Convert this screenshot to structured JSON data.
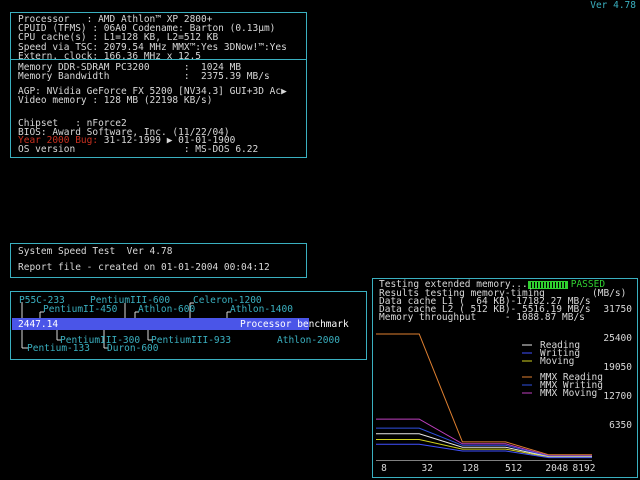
{
  "version": "Ver 4.78",
  "info": {
    "lines": [
      "Processor   : AMD Athlon™ XP 2800+",
      "CPUID (TFMS) : 06A0 Codename: Barton (0.13µm)",
      "CPU cache(s) : L1=128 KB, L2=512 KB",
      "Speed via TSC: 2079.54 MHz MMX™:Yes 3DNow!™:Yes",
      "Extern. clock: 166.36 MHz x 12.5"
    ],
    "memory_line": "Memory DDR-SDRAM PC3200      :  1024 MB",
    "bandwidth_line": "Memory Bandwidth             :  2375.39 MB/s",
    "agp_line": "AGP: NVidia GeForce FX 5200 [NV34.3] GUI+3D Ac",
    "agp_arrow": "▶",
    "video_line": "Video memory : 128 MB (22198 KB/s)",
    "chipset_line": "Chipset   : nForce2",
    "bios_line": "BIOS: Award Software, Inc. (11/22/04)",
    "y2k_label": "Year 2000 Bug:",
    "y2k_value": " 31-12-1999 ▶ 01-01-1900",
    "os_line": "OS version                   : MS-DOS 6.22"
  },
  "speed": {
    "line1": "System Speed Test  Ver 4.78",
    "line2": "Report file - created on 01-01-2004 00:04:12"
  },
  "benchmark": {
    "value": "2447.14",
    "bar_label": "Processor benchmark",
    "bar_fraction": 0.845,
    "top_labels": [
      "P55C-233",
      "PentiumIII-600",
      "Celeron-1200",
      "PentiumII-450",
      "Athlon-600",
      "Athlon-1400"
    ],
    "bottom_labels": [
      "PentiumIII-300",
      "PentiumIII-933",
      "Athlon-2000",
      "Pentium-133",
      "Duron-600"
    ]
  },
  "memtest": {
    "title": "Testing extended memory...",
    "status": "PASSED",
    "results": "Results testing memory-timing",
    "unit": "(MB/s)",
    "l1": "Data cache L1 (  64 KB)-17182.27 MB/s",
    "l2": "Data cache L2 ( 512 KB)- 5516.19 MB/s",
    "mem": "Memory throughput     - 1088.87 MB/s"
  },
  "chart_data": {
    "type": "line",
    "x_ticks": [
      "8",
      "32",
      "128",
      "512",
      "2048",
      "8192"
    ],
    "y_ticks": [
      "31750",
      "25400",
      "19050",
      "12700",
      "6350"
    ],
    "legend": [
      {
        "name": "Reading",
        "color": "#e8e8e8"
      },
      {
        "name": "Writing",
        "color": "#4050ff"
      },
      {
        "name": "Moving",
        "color": "#d0d020"
      },
      {
        "name": "MMX Reading",
        "color": "#e08030"
      },
      {
        "name": "MMX Writing",
        "color": "#3050e0"
      },
      {
        "name": "MMX Moving",
        "color": "#c040c0"
      }
    ],
    "series": [
      {
        "name": "MMX Reading",
        "color": "#e08030",
        "values": [
          26500,
          26500,
          3800,
          3800,
          1100,
          1100
        ]
      },
      {
        "name": "MMX Moving",
        "color": "#c040c0",
        "values": [
          8600,
          8600,
          3400,
          3400,
          900,
          900
        ]
      },
      {
        "name": "MMX Writing",
        "color": "#3050e0",
        "values": [
          6700,
          6700,
          3100,
          3100,
          800,
          800
        ]
      },
      {
        "name": "Reading",
        "color": "#e8e8e8",
        "values": [
          5500,
          5500,
          2700,
          2700,
          700,
          700
        ]
      },
      {
        "name": "Moving",
        "color": "#d0d020",
        "values": [
          4300,
          4300,
          2300,
          2300,
          600,
          600
        ]
      },
      {
        "name": "Writing",
        "color": "#4050ff",
        "values": [
          3300,
          3300,
          1900,
          1900,
          500,
          500
        ]
      }
    ],
    "ylim": [
      0,
      31750
    ]
  }
}
